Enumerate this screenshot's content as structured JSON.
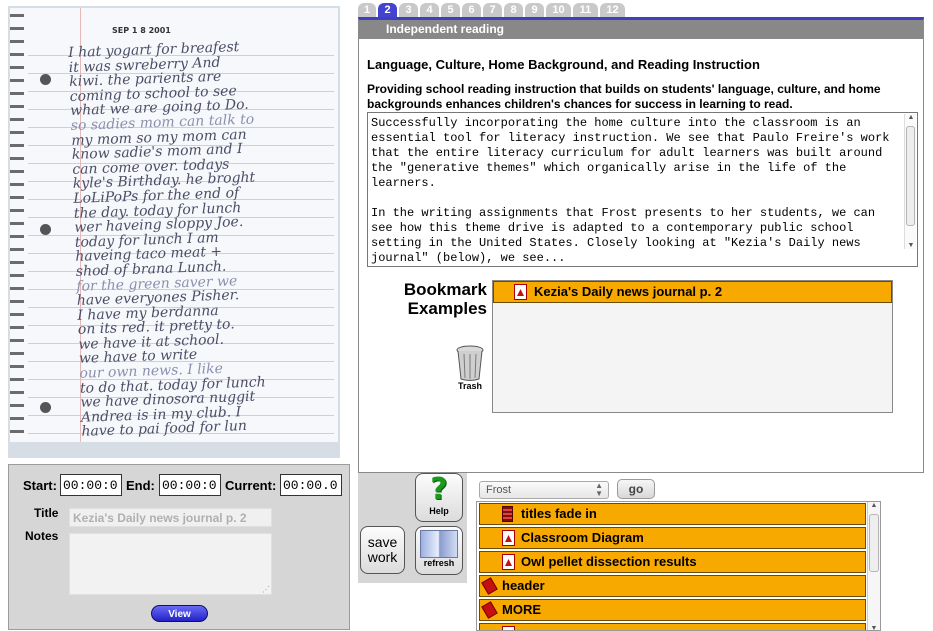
{
  "notebook_image": {
    "date": "SEP 1 8 2001",
    "handwriting": [
      "I hat yogart for breafest",
      "it was swreberry And",
      "kiwi. the parients are",
      "coming to school to see",
      "what we are going to Do.",
      "so sadies mom can talk to",
      "my mom so my mom can",
      "know sadie's mom and I",
      "can come over. todays",
      "kyle's Birthday. he broght",
      "LoLiPoPs for the end of",
      "the day. today for lunch",
      "wer haveing sloppy Joe.",
      "today for lunch I am",
      "haveing taco meat +",
      "shod of brana Lunch.",
      "for the green saver we",
      "have everyones Pisher.",
      "I have my berdanna",
      "on its red. it pretty to.",
      "we have it at school.",
      "we have to write",
      "our own news. I like",
      "to do that. today for lunch",
      "we have dinosora nuggit",
      "Andrea is in my club. I",
      "have to pai food for lun"
    ]
  },
  "timing": {
    "start_label": "Start:",
    "start_value": "00:00:0",
    "end_label": "End:",
    "end_value": "00:00:0",
    "current_label": "Current:",
    "current_value": "00:00.0",
    "title_label": "Title",
    "title_value": "Kezia's Daily news journal p. 2",
    "notes_label": "Notes",
    "notes_value": "",
    "view_button": "View"
  },
  "tools": {
    "help_label": "Help",
    "save_label": "save work",
    "refresh_label": "refresh"
  },
  "tabs": [
    "1",
    "2",
    "3",
    "4",
    "5",
    "6",
    "7",
    "8",
    "9",
    "10",
    "11",
    "12"
  ],
  "active_tab": "2",
  "reading": {
    "header": "Independent reading",
    "section_title": "Language, Culture, Home Background, and Reading Instruction",
    "summary": "Providing school reading instruction that builds on students' language, culture, and home backgrounds enhances children's chances for success in learning to read.",
    "paragraphs": [
      "Successfully incorporating the home culture into the classroom is an essential tool for literacy instruction. We see that Paulo Freire's work that the entire literacy curriculum for adult learners was built around the \"generative themes\" which organically arise in the life of the learners.",
      "In the writing assignments that Frost presents to her students, we can see how this theme drive is adapted to a contemporary public school setting in the United States. Closely looking at \"Kezia's Daily news journal\" (below), we see..."
    ]
  },
  "bookmarks": {
    "heading_line1": "Bookmark",
    "heading_line2": "Examples",
    "trash_label": "Trash",
    "items": [
      {
        "label": "Kezia's Daily news journal p. 2",
        "icon": "pdf-icon"
      }
    ]
  },
  "search": {
    "selected": "Frost",
    "go_label": "go"
  },
  "list": {
    "items": [
      {
        "label": "titles fade in",
        "icon": "film-icon",
        "indent": true
      },
      {
        "label": "Classroom Diagram",
        "icon": "pdf-icon",
        "indent": true
      },
      {
        "label": "Owl pellet dissection results",
        "icon": "pdf-icon",
        "indent": true
      },
      {
        "label": "header",
        "icon": "document-icon",
        "indent": false
      },
      {
        "label": "MORE",
        "icon": "document-icon",
        "indent": false
      },
      {
        "label": "",
        "icon": "pdf-icon",
        "indent": true
      }
    ]
  },
  "colors": {
    "accent": "#3f3fc0",
    "item_orange": "#f8a900",
    "header_gray": "#888888",
    "panel_gray": "#d6d6d6"
  }
}
